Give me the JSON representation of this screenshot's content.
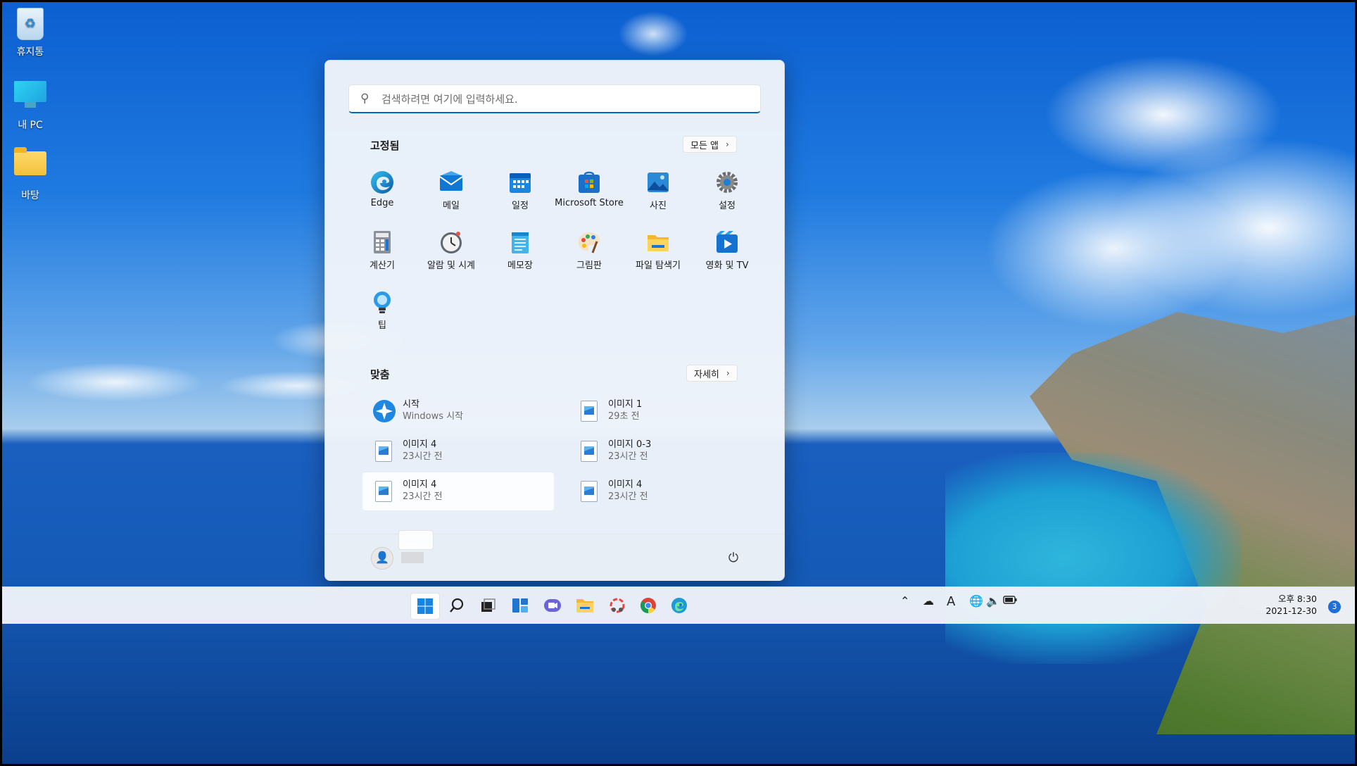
{
  "desktop": {
    "icons": [
      {
        "label": "휴지통",
        "icon": "recycle-bin-icon"
      },
      {
        "label": "내 PC",
        "icon": "computer-icon"
      },
      {
        "label": "바탕",
        "icon": "folder-icon"
      }
    ]
  },
  "start_menu": {
    "search_placeholder": "검색하려면 여기에 입력하세요.",
    "pinned_title": "고정됨",
    "all_apps_label": "모든 앱",
    "pinned_apps": [
      {
        "label": "Edge",
        "icon": "edge-icon"
      },
      {
        "label": "메일",
        "icon": "mail-icon"
      },
      {
        "label": "일정",
        "icon": "calendar-icon"
      },
      {
        "label": "Microsoft Store",
        "icon": "store-icon"
      },
      {
        "label": "사진",
        "icon": "photos-icon"
      },
      {
        "label": "설정",
        "icon": "settings-icon"
      },
      {
        "label": "계산기",
        "icon": "calculator-icon"
      },
      {
        "label": "알람 및 시계",
        "icon": "clock-icon"
      },
      {
        "label": "메모장",
        "icon": "notepad-icon"
      },
      {
        "label": "그림판",
        "icon": "paint-icon"
      },
      {
        "label": "파일 탐색기",
        "icon": "file-explorer-icon"
      },
      {
        "label": "영화 및 TV",
        "icon": "movies-tv-icon"
      },
      {
        "label": "팁",
        "icon": "tips-icon"
      }
    ],
    "recommended_title": "맞춤",
    "more_label": "자세히",
    "recommended": [
      {
        "name": "시작",
        "sub": "Windows 시작",
        "icon": "get-started-icon"
      },
      {
        "name": "이미지 1",
        "sub": "29초 전",
        "icon": "image-file-icon"
      },
      {
        "name": "이미지 4",
        "sub": "23시간 전",
        "icon": "image-file-icon"
      },
      {
        "name": "이미지 0-3",
        "sub": "23시간 전",
        "icon": "image-file-icon"
      },
      {
        "name": "이미지 4",
        "sub": "23시간 전",
        "icon": "image-file-icon"
      },
      {
        "name": "이미지 4",
        "sub": "23시간 전",
        "icon": "image-file-icon"
      }
    ]
  },
  "taskbar": {
    "apps": [
      "start-icon",
      "search-icon",
      "task-view-icon",
      "widgets-icon",
      "chat-icon",
      "file-explorer-icon",
      "snipping-tool-icon",
      "chrome-icon",
      "edge-icon"
    ],
    "tray": {
      "ime_label": "A",
      "time": "오후 8:30",
      "date": "2021-12-30",
      "notification_count": "3"
    }
  }
}
